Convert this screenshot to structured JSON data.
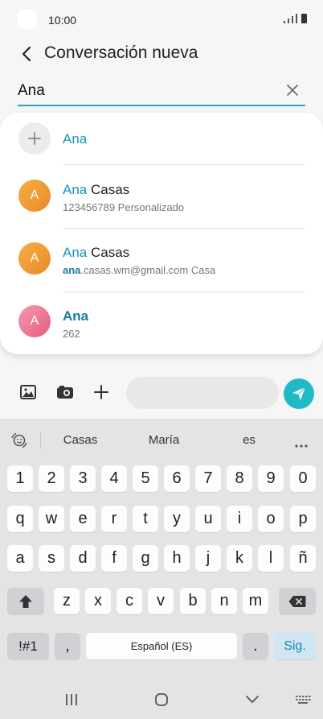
{
  "status": {
    "time": "10:00"
  },
  "header": {
    "title": "Conversación nueva"
  },
  "recipient": {
    "value": "Ana"
  },
  "suggestions": [
    {
      "highlight": "Ana",
      "rest": "",
      "sub_highlight": "",
      "sub": ""
    },
    {
      "highlight": "Ana",
      "rest": " Casas",
      "avatar_letter": "A",
      "sub_highlight": "",
      "sub": "123456789  Personalizado"
    },
    {
      "highlight": "Ana",
      "rest": " Casas",
      "avatar_letter": "A",
      "sub_highlight": "ana",
      "sub": ".casas.wm@gmail.com  Casa"
    },
    {
      "highlight": "Ana",
      "rest": "",
      "avatar_letter": "A",
      "sub_highlight": "",
      "sub": "262"
    }
  ],
  "keyboard": {
    "suggestions": [
      "Casas",
      "María",
      "es"
    ],
    "row_numbers": [
      "1",
      "2",
      "3",
      "4",
      "5",
      "6",
      "7",
      "8",
      "9",
      "0"
    ],
    "row_q": [
      "q",
      "w",
      "e",
      "r",
      "t",
      "y",
      "u",
      "i",
      "o",
      "p"
    ],
    "row_a": [
      "a",
      "s",
      "d",
      "f",
      "g",
      "h",
      "j",
      "k",
      "l",
      "ñ"
    ],
    "row_z": [
      "z",
      "x",
      "c",
      "v",
      "b",
      "n",
      "m"
    ],
    "sym_label": "!#1",
    "comma": ",",
    "space_label": "Español (ES)",
    "period": ".",
    "enter_label": "Sig."
  },
  "colors": {
    "accent": "#1ea4c6",
    "send": "#1fbac6",
    "orange": "#ec9a33",
    "pink": "#ea7491"
  }
}
